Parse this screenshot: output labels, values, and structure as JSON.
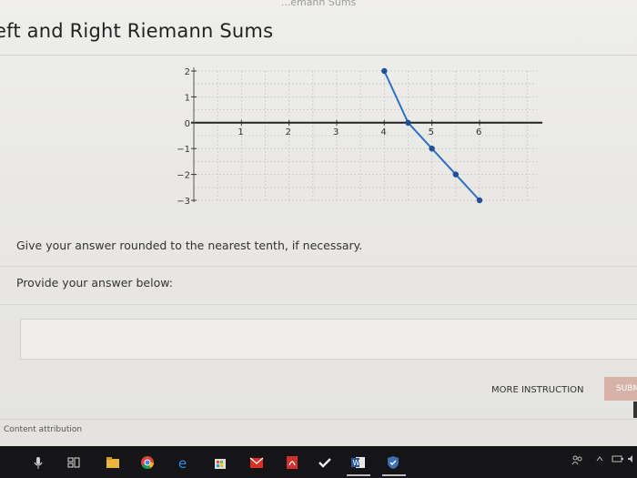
{
  "header": {
    "top_fragment": "...emann Sums",
    "title": "eft and Right Riemann Sums"
  },
  "chart_data": {
    "type": "line",
    "xlim": [
      0,
      7
    ],
    "ylim": [
      -3,
      2
    ],
    "x_ticks": [
      "1",
      "2",
      "3",
      "4",
      "5",
      "6"
    ],
    "y_ticks": [
      "2",
      "1",
      "0",
      "−1",
      "−2",
      "−3"
    ],
    "grid": true,
    "series": [
      {
        "color": "#2e6fc3",
        "points": [
          [
            4,
            2
          ],
          [
            4.5,
            0
          ],
          [
            5,
            -1
          ],
          [
            5.5,
            -2
          ],
          [
            6,
            -3
          ]
        ]
      }
    ]
  },
  "question": {
    "text": "Give your answer rounded to the nearest tenth, if necessary."
  },
  "answer": {
    "label": "Provide your answer below:",
    "value": ""
  },
  "buttons": {
    "more": "MORE INSTRUCTION",
    "submit": "SUBM"
  },
  "footer": {
    "attribution": "Content attribution"
  },
  "taskbar": {
    "icons": [
      "microphone-icon",
      "task-view-icon",
      "file-explorer-icon",
      "chrome-icon",
      "edge-icon",
      "store-icon",
      "gmail-icon",
      "acrobat-icon",
      "checkmark-app-icon",
      "word-icon",
      "security-app-icon"
    ],
    "tray": [
      "people-icon",
      "tray-chevron-icon",
      "battery-icon",
      "volume-icon"
    ]
  }
}
